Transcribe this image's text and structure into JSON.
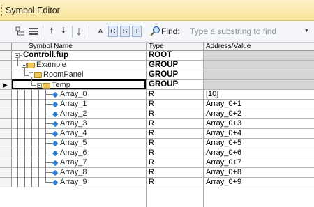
{
  "window": {
    "title": "Symbol Editor"
  },
  "toolbar": {
    "buttons": [
      "A",
      "C",
      "S",
      "T"
    ],
    "find_label": "Find:",
    "find_placeholder": "Type a substring to find"
  },
  "table": {
    "headers": [
      "Symbol Name",
      "Type",
      "Address/Value"
    ],
    "rows": [
      {
        "name": "Controll.fup",
        "type": "ROOT",
        "value": ""
      },
      {
        "name": "Example",
        "type": "GROUP",
        "value": ""
      },
      {
        "name": "RoomPanel",
        "type": "GROUP",
        "value": ""
      },
      {
        "name": "Temp",
        "type": "GROUP",
        "value": ""
      },
      {
        "name": "Array_0",
        "type": "R",
        "value": "[10]"
      },
      {
        "name": "Array_1",
        "type": "R",
        "value": "Array_0+1"
      },
      {
        "name": "Array_2",
        "type": "R",
        "value": "Array_0+2"
      },
      {
        "name": "Array_3",
        "type": "R",
        "value": "Array_0+3"
      },
      {
        "name": "Array_4",
        "type": "R",
        "value": "Array_0+4"
      },
      {
        "name": "Array_5",
        "type": "R",
        "value": "Array_0+5"
      },
      {
        "name": "Array_6",
        "type": "R",
        "value": "Array_0+6"
      },
      {
        "name": "Array_7",
        "type": "R",
        "value": "Array_0+7"
      },
      {
        "name": "Array_8",
        "type": "R",
        "value": "Array_0+8"
      },
      {
        "name": "Array_9",
        "type": "R",
        "value": "Array_0+9"
      }
    ]
  }
}
